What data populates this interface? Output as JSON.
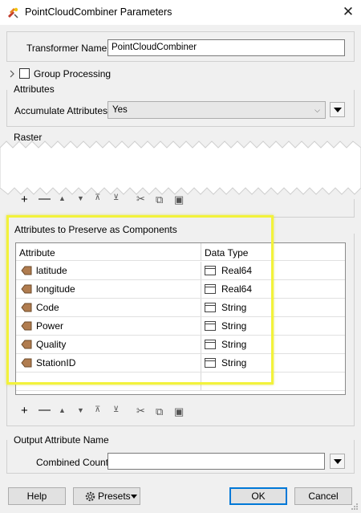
{
  "window": {
    "title": "PointCloudCombiner Parameters",
    "close_symbol": "✕"
  },
  "transformer": {
    "label": "Transformer Name:",
    "value": "PointCloudCombiner"
  },
  "group_processing": {
    "label": "Group Processing",
    "checked": false
  },
  "attributes_section": {
    "title": "Attributes",
    "accumulate_label": "Accumulate Attributes:",
    "accumulate_value": "Yes"
  },
  "raster_section": {
    "title": "Raster"
  },
  "components_section": {
    "title": "Attributes to Preserve as Components",
    "columns": [
      "Attribute",
      "Data Type"
    ],
    "rows": [
      {
        "attribute": "latitude",
        "type": "Real64"
      },
      {
        "attribute": "longitude",
        "type": "Real64"
      },
      {
        "attribute": "Code",
        "type": "String"
      },
      {
        "attribute": "Power",
        "type": "String"
      },
      {
        "attribute": "Quality",
        "type": "String"
      },
      {
        "attribute": "StationID",
        "type": "String"
      }
    ]
  },
  "output_section": {
    "title": "Output Attribute Name",
    "combined_label": "Combined Count:",
    "combined_value": ""
  },
  "buttons": {
    "help": "Help",
    "presets": "Presets",
    "ok": "OK",
    "cancel": "Cancel"
  },
  "colors": {
    "highlight": "#f2f23a",
    "attr_icon": "#b07c4f",
    "ok_border": "#0078d7"
  },
  "icons": [
    "fme-app-icon",
    "close-icon",
    "chevron-right-icon",
    "add-icon",
    "remove-icon",
    "move-up-icon",
    "move-down-icon",
    "move-top-icon",
    "move-bottom-icon",
    "cut-icon",
    "copy-icon",
    "paste-icon",
    "attribute-icon",
    "datatype-icon",
    "gear-icon",
    "dropdown-icon"
  ]
}
